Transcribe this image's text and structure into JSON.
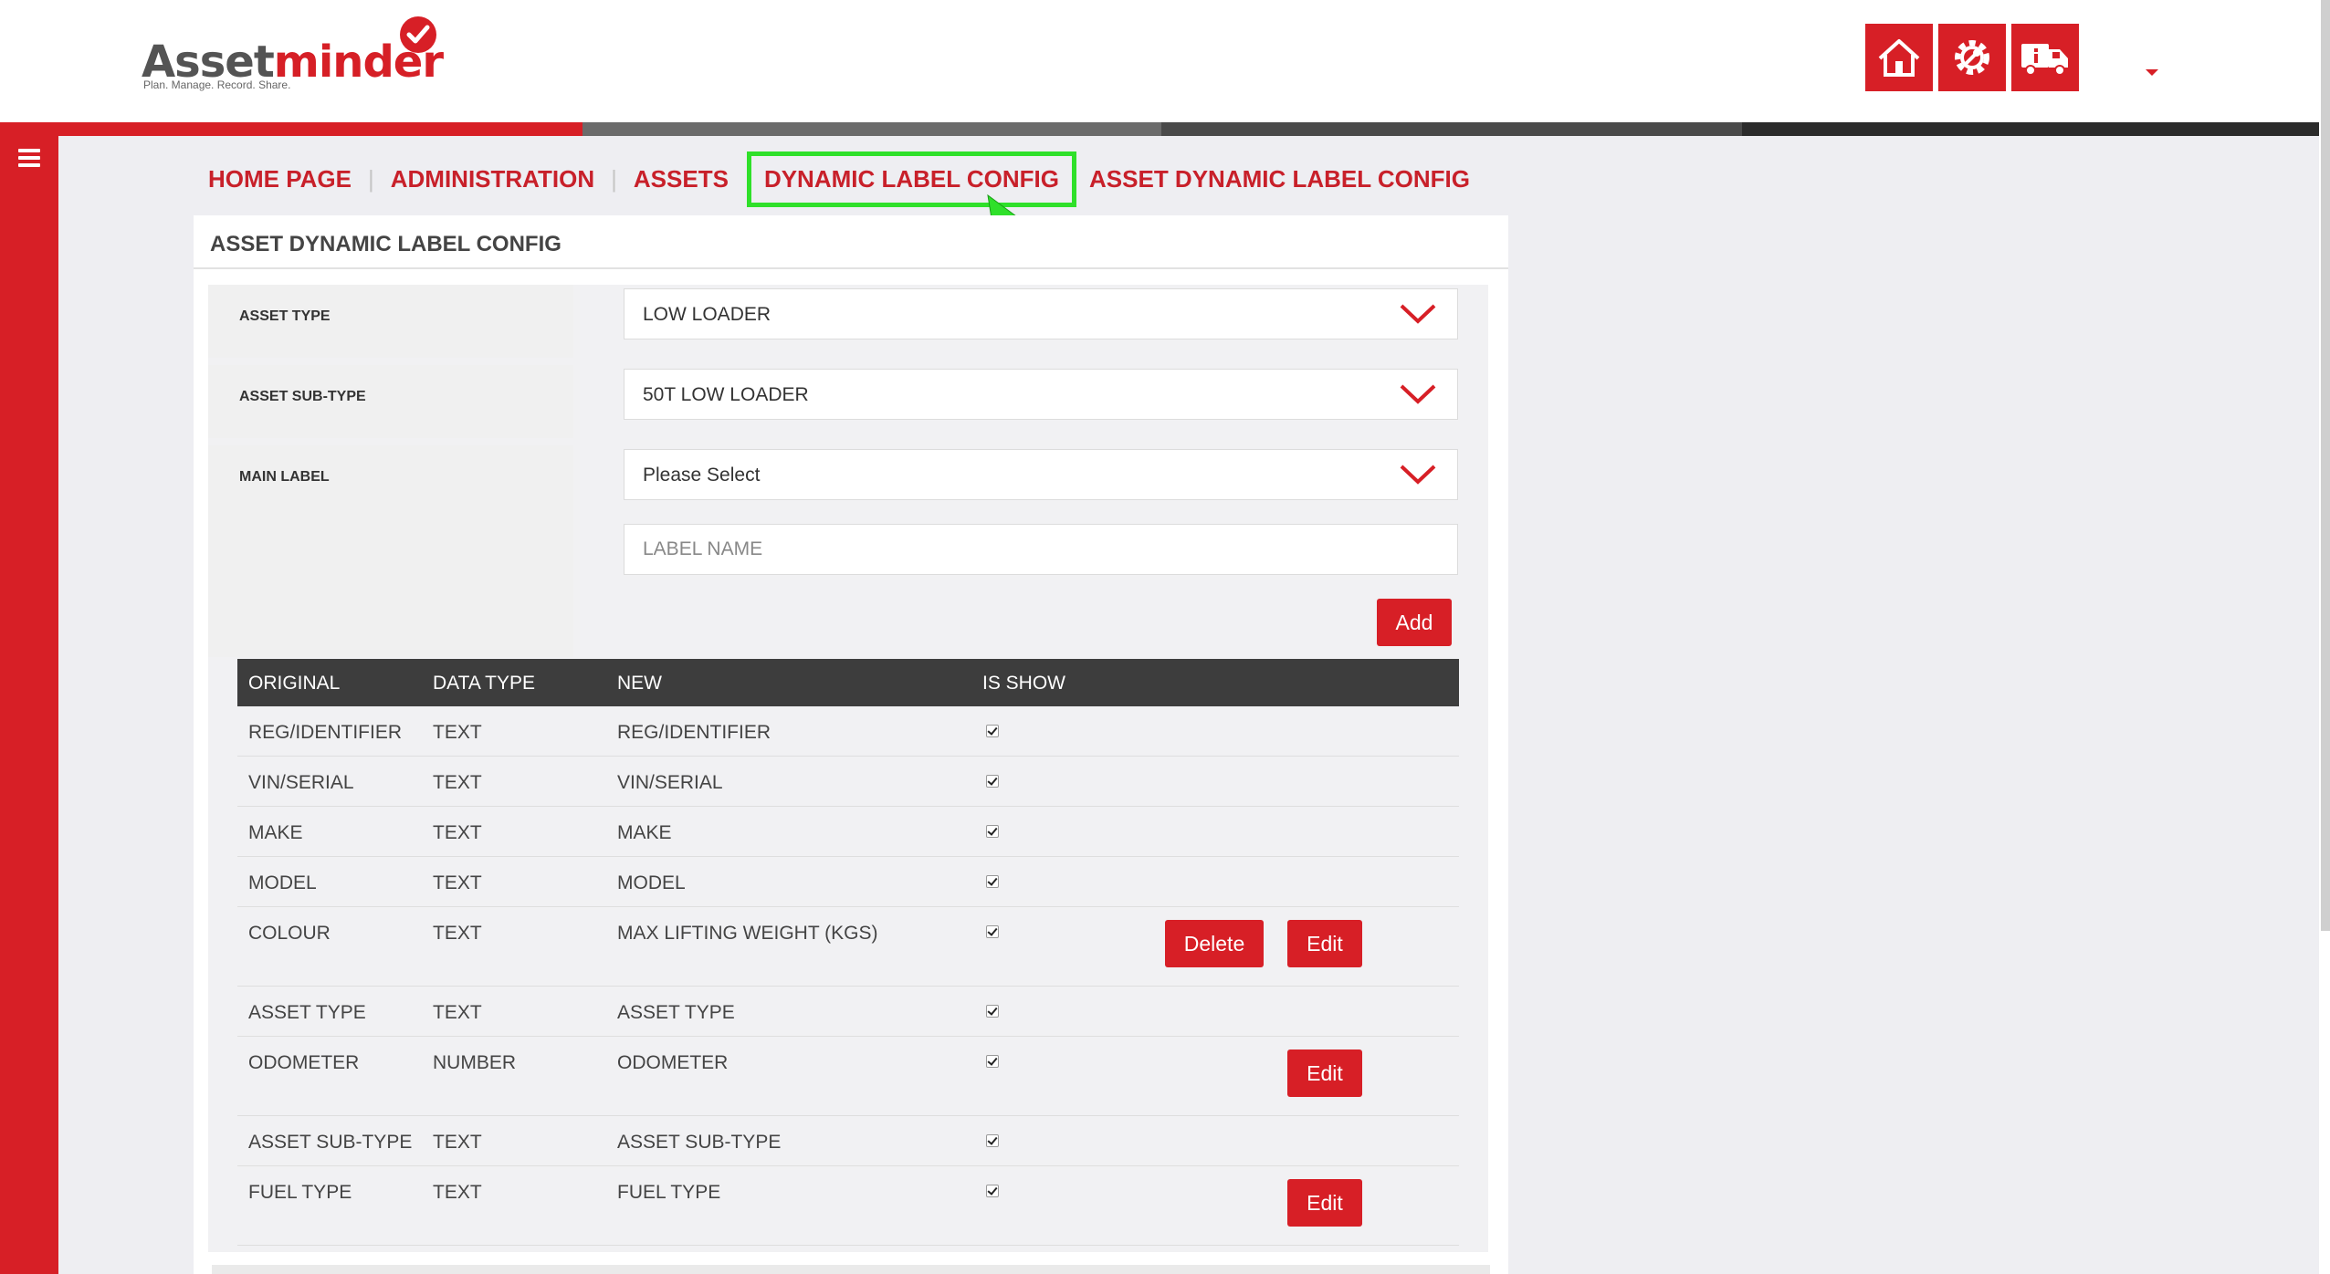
{
  "brand": {
    "name_part1": "Asset",
    "name_part2": "minder",
    "tagline": "Plan. Manage. Record. Share.",
    "primary_color": "#d71f26",
    "highlight_color": "#2fe02a"
  },
  "header": {
    "icons": [
      "home-icon",
      "settings-gear-icon",
      "truck-info-icon"
    ]
  },
  "breadcrumb": {
    "items": [
      "HOME PAGE",
      "ADMINISTRATION",
      "ASSETS",
      "DYNAMIC LABEL CONFIG",
      "ASSET DYNAMIC LABEL CONFIG"
    ]
  },
  "panel": {
    "title": "ASSET DYNAMIC LABEL CONFIG"
  },
  "form": {
    "asset_type_label": "ASSET TYPE",
    "asset_type_value": "LOW LOADER",
    "asset_subtype_label": "ASSET SUB-TYPE",
    "asset_subtype_value": "50T LOW LOADER",
    "main_label_label": "MAIN LABEL",
    "main_label_value": "Please Select",
    "label_name_placeholder": "LABEL NAME",
    "add_label": "Add"
  },
  "table": {
    "headers": [
      "ORIGINAL",
      "DATA TYPE",
      "NEW",
      "IS SHOW"
    ],
    "delete_label": "Delete",
    "edit_label": "Edit",
    "rows": [
      {
        "original": "REG/IDENTIFIER",
        "data_type": "TEXT",
        "new": "REG/IDENTIFIER",
        "is_show": true
      },
      {
        "original": "VIN/SERIAL",
        "data_type": "TEXT",
        "new": "VIN/SERIAL",
        "is_show": true
      },
      {
        "original": "MAKE",
        "data_type": "TEXT",
        "new": "MAKE",
        "is_show": true
      },
      {
        "original": "MODEL",
        "data_type": "TEXT",
        "new": "MODEL",
        "is_show": true
      },
      {
        "original": "COLOUR",
        "data_type": "TEXT",
        "new": "MAX LIFTING WEIGHT (KGS)",
        "is_show": true
      },
      {
        "original": "ASSET TYPE",
        "data_type": "TEXT",
        "new": "ASSET TYPE",
        "is_show": true
      },
      {
        "original": "ODOMETER",
        "data_type": "NUMBER",
        "new": "ODOMETER",
        "is_show": true
      },
      {
        "original": "ASSET SUB-TYPE",
        "data_type": "TEXT",
        "new": "ASSET SUB-TYPE",
        "is_show": true
      },
      {
        "original": "FUEL TYPE",
        "data_type": "TEXT",
        "new": "FUEL TYPE",
        "is_show": true
      }
    ]
  }
}
